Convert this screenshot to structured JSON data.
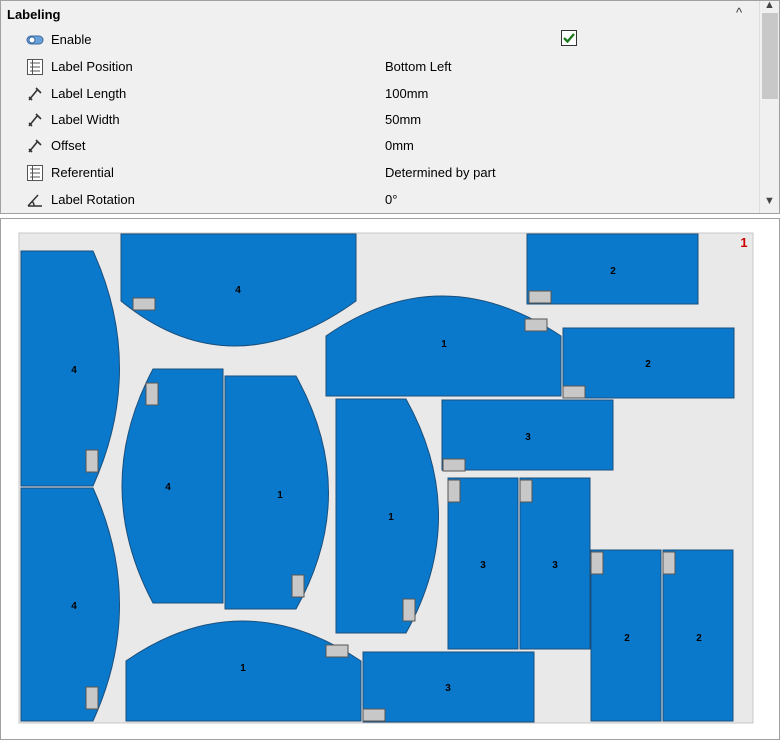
{
  "panel": {
    "header": "Labeling",
    "collapse_glyph": "^",
    "rows": [
      {
        "name": "Enable",
        "icon": "toggle-icon",
        "value": "",
        "checked": true
      },
      {
        "name": "Label Position",
        "icon": "list-icon",
        "value": "Bottom Left"
      },
      {
        "name": "Label Length",
        "icon": "caliper-icon",
        "value": "100mm"
      },
      {
        "name": "Label Width",
        "icon": "caliper-icon",
        "value": "50mm"
      },
      {
        "name": "Offset",
        "icon": "caliper-icon",
        "value": "0mm"
      },
      {
        "name": "Referential",
        "icon": "list-icon",
        "value": "Determined by part"
      },
      {
        "name": "Label Rotation",
        "icon": "angle-icon",
        "value": "0°"
      }
    ]
  },
  "preview": {
    "sheet_number": "1",
    "colors": {
      "part_fill": "#0a79cc",
      "part_stroke": "#1a4f7d",
      "sheet": "#e9e9e9",
      "label_fill": "#c8c8c8",
      "sheet_number": "#cc0000"
    },
    "part_labels": [
      "4",
      "2",
      "1",
      "4",
      "2",
      "4",
      "1",
      "1",
      "3",
      "3",
      "3",
      "4",
      "1",
      "3",
      "2",
      "2"
    ]
  }
}
